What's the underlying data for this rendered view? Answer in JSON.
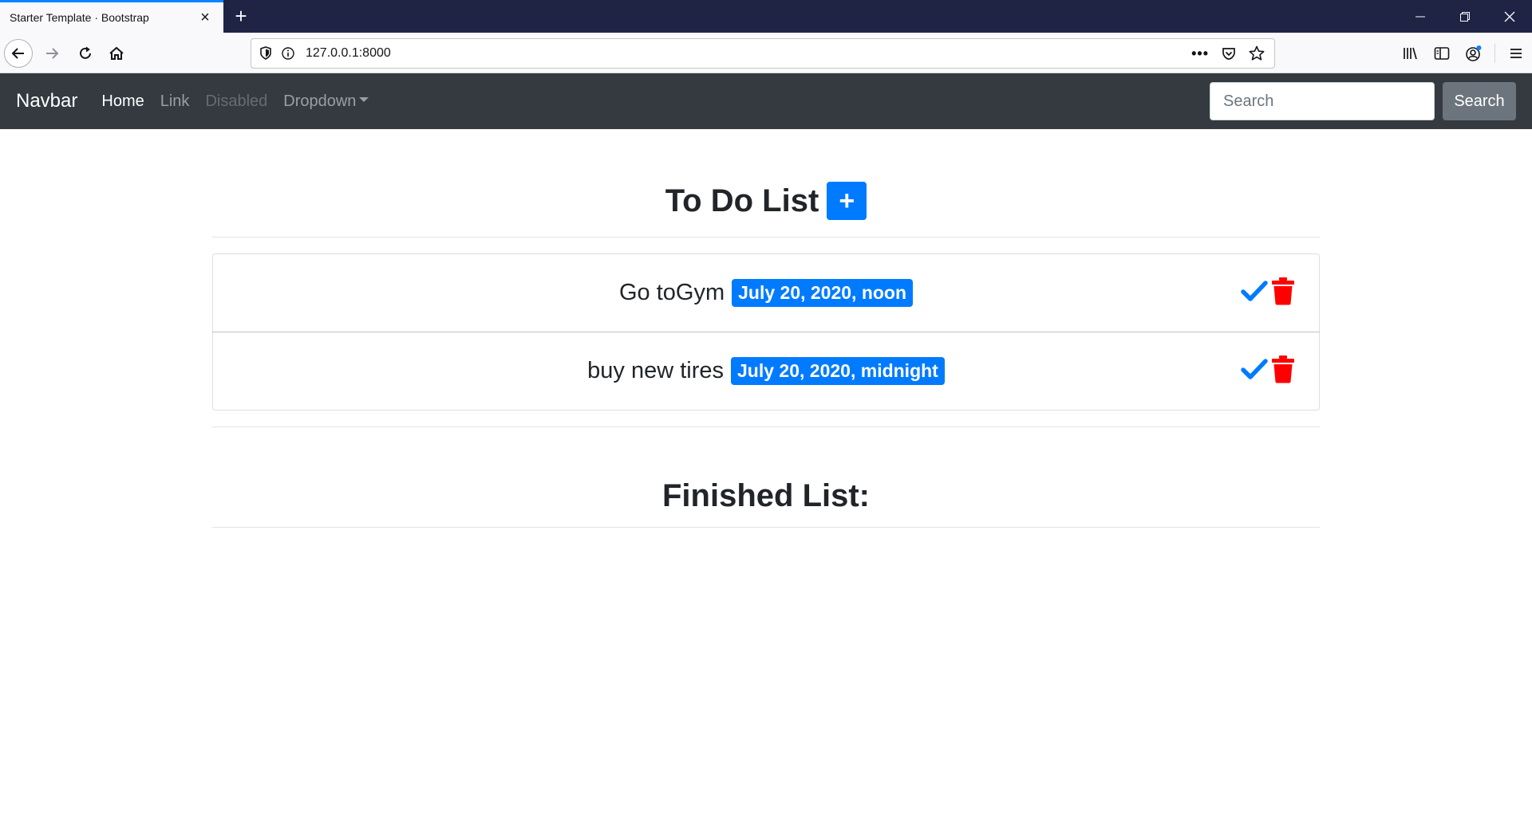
{
  "browser": {
    "tab_title": "Starter Template · Bootstrap",
    "url": "127.0.0.1:8000"
  },
  "navbar": {
    "brand": "Navbar",
    "links": [
      "Home",
      "Link",
      "Disabled",
      "Dropdown"
    ],
    "search_placeholder": "Search",
    "search_button": "Search"
  },
  "todo": {
    "title": "To Do List",
    "add_symbol": "+",
    "items": [
      {
        "text": "Go toGym",
        "date": "July 20, 2020, noon"
      },
      {
        "text": "buy new tires",
        "date": "July 20, 2020, midnight"
      }
    ]
  },
  "finished": {
    "title": "Finished List:"
  },
  "colors": {
    "primary": "#007bff",
    "danger": "#ff0000",
    "navbar_bg": "#343a40",
    "tabbar_bg": "#1f2344"
  },
  "icons": {
    "complete": "checkmark-icon",
    "delete": "trash-icon",
    "add": "plus-icon"
  }
}
